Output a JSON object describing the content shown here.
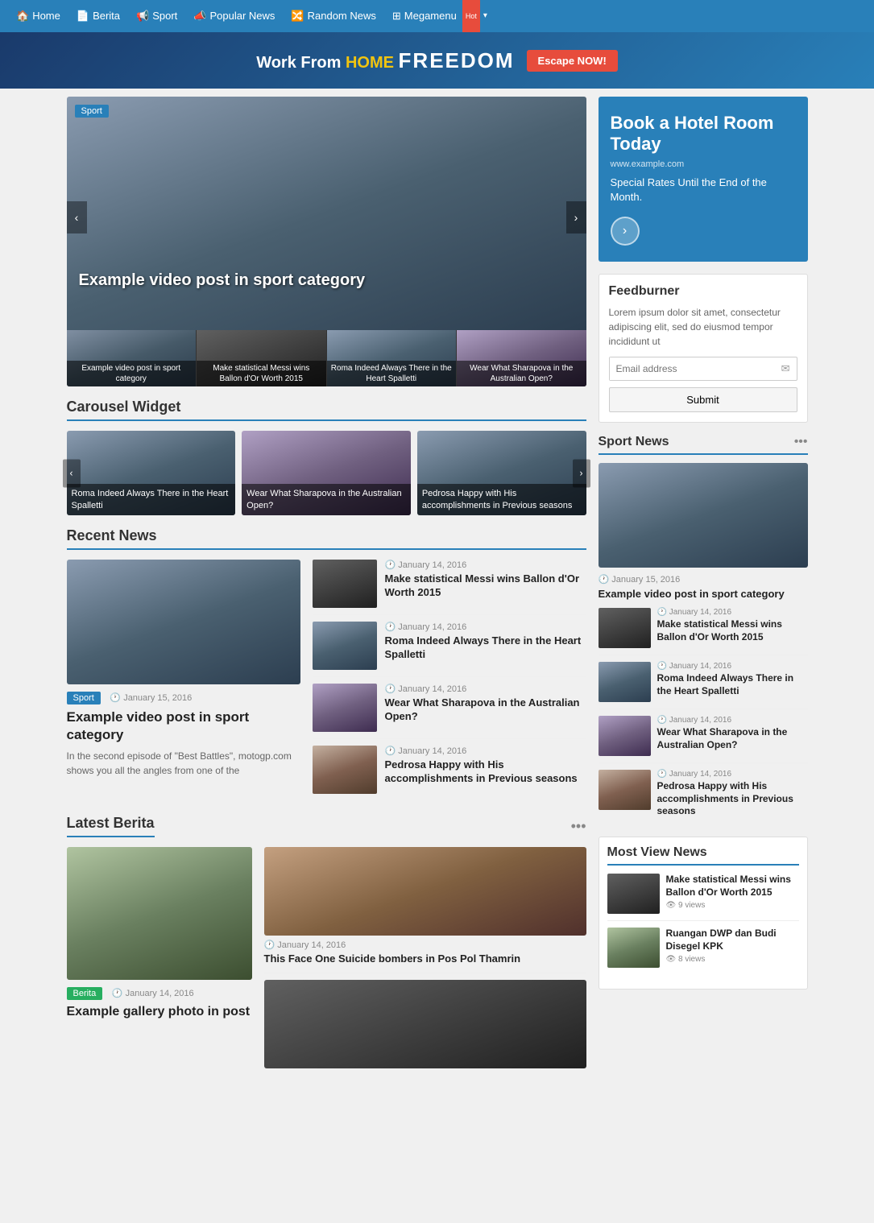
{
  "nav": {
    "items": [
      {
        "label": "Home",
        "icon": "home-icon",
        "href": "#"
      },
      {
        "label": "Berita",
        "icon": "newspaper-icon",
        "href": "#"
      },
      {
        "label": "Sport",
        "icon": "sport-icon",
        "href": "#"
      },
      {
        "label": "Popular News",
        "icon": "megaphone-icon",
        "href": "#"
      },
      {
        "label": "Random News",
        "icon": "random-icon",
        "href": "#"
      },
      {
        "label": "Megamenu",
        "icon": "grid-icon",
        "href": "#",
        "badge": "Hot"
      }
    ]
  },
  "banner": {
    "prefix": "Work From ",
    "home": "HOME",
    "freedom": "FREEDOM",
    "button": "Escape NOW!"
  },
  "hero": {
    "main": {
      "badge": "Sport",
      "title": "Example video post in sport category"
    },
    "thumbs": [
      {
        "title": "Example video post in sport category",
        "color": "img-sport"
      },
      {
        "title": "Make statistical Messi wins Ballon d'Or Worth 2015",
        "color": "img-sport"
      },
      {
        "title": "Roma Indeed Always There in the Heart Spalletti",
        "color": "img-sport"
      },
      {
        "title": "Wear What Sharapova in the Australian Open?",
        "color": "img-tennis"
      }
    ]
  },
  "carousel": {
    "title": "Carousel Widget",
    "items": [
      {
        "title": "Roma Indeed Always There in the Heart Spalletti",
        "color": "img-sport"
      },
      {
        "title": "Wear What Sharapova in the Australian Open?",
        "color": "img-tennis"
      },
      {
        "title": "Pedrosa Happy with His accomplishments in Previous seasons",
        "color": "img-sport"
      }
    ]
  },
  "recent_news": {
    "title": "Recent News",
    "main": {
      "badge": "Sport",
      "date": "January 15, 2016",
      "title": "Example video post in sport category",
      "excerpt": "In the second episode of \"Best Battles\", motogp.com shows you all the angles from one of the"
    },
    "list": [
      {
        "date": "January 14, 2016",
        "title": "Make statistical Messi wins Ballon d'Or Worth 2015",
        "color": "img-dark"
      },
      {
        "date": "January 14, 2016",
        "title": "Roma Indeed Always There in the Heart Spalletti",
        "color": "img-sport"
      },
      {
        "date": "January 14, 2016",
        "title": "Wear What Sharapova in the Australian Open?",
        "color": "img-tennis"
      },
      {
        "date": "January 14, 2016",
        "title": "Pedrosa Happy with His accomplishments in Previous seasons",
        "color": "img-moto"
      }
    ]
  },
  "latest_berita": {
    "title": "Latest Berita",
    "main": {
      "badge": "Berita",
      "date": "January 14, 2016",
      "title": "Example gallery photo in post"
    },
    "side": [
      {
        "date": "January 14, 2016",
        "title": "This Face One Suicide bombers in Pos Pol Thamrin",
        "color": "img-face"
      },
      {
        "date": "",
        "title": "",
        "color": "img-dark"
      }
    ]
  },
  "sidebar": {
    "ad": {
      "title": "Book a Hotel Room Today",
      "url": "www.example.com",
      "desc": "Special Rates Until the End of the Month."
    },
    "feedburner": {
      "title": "Feedburner",
      "desc": "Lorem ipsum dolor sit amet, consectetur adipiscing elit, sed do eiusmod tempor incididunt ut",
      "email_placeholder": "Email address",
      "submit_label": "Submit"
    },
    "sport_news": {
      "title": "Sport News",
      "main": {
        "date": "January 15, 2016",
        "title": "Example video post in sport category"
      },
      "list": [
        {
          "date": "January 14, 2016",
          "title": "Make statistical Messi wins Ballon d'Or Worth 2015",
          "color": "img-dark"
        },
        {
          "date": "January 14, 2016",
          "title": "Roma Indeed Always There in the Heart Spalletti",
          "color": "img-sport"
        },
        {
          "date": "January 14, 2016",
          "title": "Wear What Sharapova in the Australian Open?",
          "color": "img-tennis"
        },
        {
          "date": "January 14, 2016",
          "title": "Pedrosa Happy with His accomplishments in Previous seasons",
          "color": "img-moto"
        }
      ]
    },
    "most_view": {
      "title": "Most View News",
      "items": [
        {
          "title": "Make statistical Messi wins Ballon d'Or Worth 2015",
          "views": "9 views",
          "color": "img-dark"
        },
        {
          "title": "Ruangan DWP dan Budi Disegel KPK",
          "views": "8 views",
          "color": "img-berita"
        }
      ]
    }
  }
}
